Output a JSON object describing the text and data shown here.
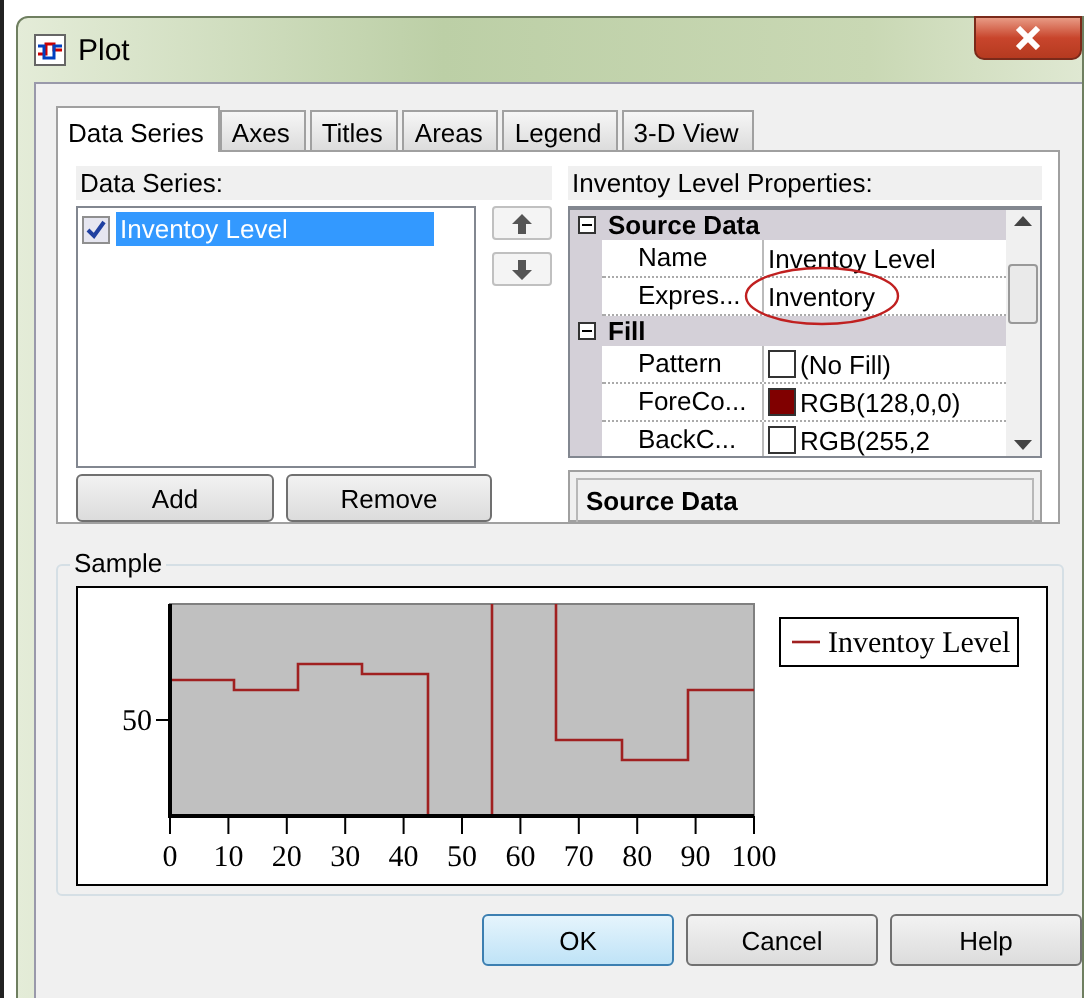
{
  "window": {
    "title": "Plot"
  },
  "tabs": [
    {
      "label": "Data Series",
      "selected": true
    },
    {
      "label": "Axes",
      "selected": false
    },
    {
      "label": "Titles",
      "selected": false
    },
    {
      "label": "Areas",
      "selected": false
    },
    {
      "label": "Legend",
      "selected": false
    },
    {
      "label": "3-D View",
      "selected": false
    }
  ],
  "series_panel": {
    "label": "Data Series:",
    "items": [
      {
        "label": "Inventoy Level",
        "checked": true,
        "selected": true
      }
    ],
    "buttons": [
      "Add",
      "Remove"
    ]
  },
  "properties": {
    "label": "Inventoy Level Properties:",
    "categories": [
      {
        "title": "Source Data",
        "expanded": true,
        "rows": [
          {
            "name": "Name",
            "value": "Inventoy Level",
            "circled": false
          },
          {
            "name": "Expres...",
            "value": "Inventory",
            "circled": true
          }
        ]
      },
      {
        "title": "Fill",
        "expanded": true,
        "rows": [
          {
            "name": "Pattern",
            "value": "(No Fill)",
            "circled": false,
            "color": "#ffffff"
          },
          {
            "name": "ForeCo...",
            "value": "RGB(128,0,0)",
            "circled": false,
            "color": "#800000"
          },
          {
            "name": "BackC...",
            "value": "RGB(255,2",
            "circled": false,
            "color": "#ffffff"
          }
        ]
      }
    ],
    "description": "Source Data"
  },
  "sample": {
    "label": "Sample",
    "legend": "Inventoy Level",
    "y_labels": [
      "50"
    ],
    "x_labels": [
      "0",
      "10",
      "20",
      "30",
      "40",
      "50",
      "60",
      "70",
      "80",
      "90",
      "100"
    ]
  },
  "buttons": [
    {
      "label": "OK",
      "default": true
    },
    {
      "label": "Cancel",
      "default": false
    },
    {
      "label": "Help",
      "default": false
    }
  ]
}
